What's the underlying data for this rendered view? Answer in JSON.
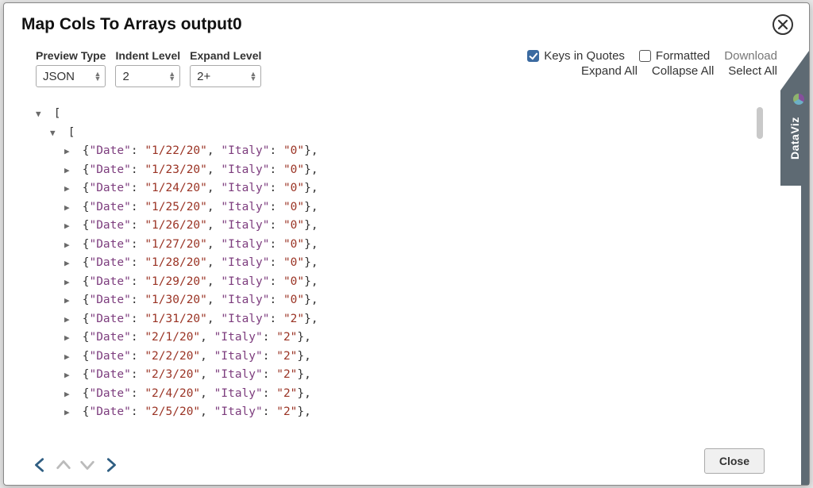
{
  "title": "Map Cols To Arrays output0",
  "labels": {
    "preview_type": "Preview Type",
    "indent_level": "Indent Level",
    "expand_level": "Expand Level"
  },
  "selects": {
    "preview_type": "JSON",
    "indent_level": "2",
    "expand_level": "2+"
  },
  "options": {
    "keys_in_quotes_label": "Keys in Quotes",
    "keys_in_quotes_checked": true,
    "formatted_label": "Formatted",
    "formatted_checked": false,
    "download": "Download",
    "expand_all": "Expand All",
    "collapse_all": "Collapse All",
    "select_all": "Select All"
  },
  "buttons": {
    "close": "Close"
  },
  "side_tab": "DataViz",
  "tree": {
    "open_bracket": "[",
    "rows": [
      {
        "date_key": "Date",
        "date": "1/22/20",
        "italy_key": "Italy",
        "italy": "0"
      },
      {
        "date_key": "Date",
        "date": "1/23/20",
        "italy_key": "Italy",
        "italy": "0"
      },
      {
        "date_key": "Date",
        "date": "1/24/20",
        "italy_key": "Italy",
        "italy": "0"
      },
      {
        "date_key": "Date",
        "date": "1/25/20",
        "italy_key": "Italy",
        "italy": "0"
      },
      {
        "date_key": "Date",
        "date": "1/26/20",
        "italy_key": "Italy",
        "italy": "0"
      },
      {
        "date_key": "Date",
        "date": "1/27/20",
        "italy_key": "Italy",
        "italy": "0"
      },
      {
        "date_key": "Date",
        "date": "1/28/20",
        "italy_key": "Italy",
        "italy": "0"
      },
      {
        "date_key": "Date",
        "date": "1/29/20",
        "italy_key": "Italy",
        "italy": "0"
      },
      {
        "date_key": "Date",
        "date": "1/30/20",
        "italy_key": "Italy",
        "italy": "0"
      },
      {
        "date_key": "Date",
        "date": "1/31/20",
        "italy_key": "Italy",
        "italy": "2"
      },
      {
        "date_key": "Date",
        "date": "2/1/20",
        "italy_key": "Italy",
        "italy": "2"
      },
      {
        "date_key": "Date",
        "date": "2/2/20",
        "italy_key": "Italy",
        "italy": "2"
      },
      {
        "date_key": "Date",
        "date": "2/3/20",
        "italy_key": "Italy",
        "italy": "2"
      },
      {
        "date_key": "Date",
        "date": "2/4/20",
        "italy_key": "Italy",
        "italy": "2"
      },
      {
        "date_key": "Date",
        "date": "2/5/20",
        "italy_key": "Italy",
        "italy": "2"
      }
    ]
  }
}
